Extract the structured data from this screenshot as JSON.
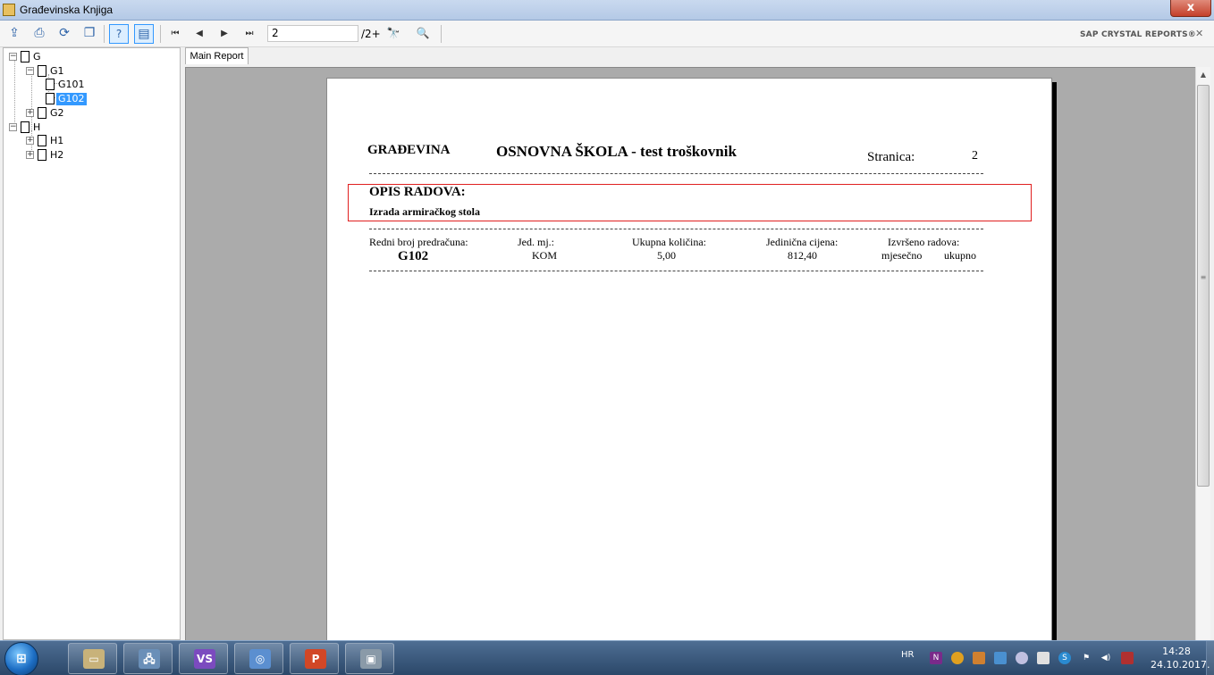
{
  "window": {
    "title": "Građevinska Knjiga",
    "close_label": "x"
  },
  "toolbar": {
    "buttons": [
      {
        "name": "export-icon",
        "glyph": "⇪"
      },
      {
        "name": "print-icon",
        "glyph": "⎙"
      },
      {
        "name": "refresh-icon",
        "glyph": "⟳"
      },
      {
        "name": "copy-icon",
        "glyph": "❐"
      },
      {
        "name": "help-icon",
        "glyph": "?"
      },
      {
        "name": "group-tree-icon",
        "glyph": "▤"
      }
    ],
    "nav": [
      {
        "name": "first-page-icon",
        "glyph": "⏮"
      },
      {
        "name": "prev-page-icon",
        "glyph": "◀"
      },
      {
        "name": "next-page-icon",
        "glyph": "▶"
      },
      {
        "name": "last-page-icon",
        "glyph": "⏭"
      }
    ],
    "page_value": "2",
    "page_total": "/2+",
    "find_glyph": "🔭",
    "zoom_glyph": "🔍",
    "brand": "SAP CRYSTAL REPORTS®",
    "brand_close": "✕"
  },
  "tree": {
    "nodes": [
      {
        "label": "G",
        "expander": "−",
        "level": 0,
        "selected": false
      },
      {
        "label": "G1",
        "expander": "−",
        "level": 1,
        "selected": false
      },
      {
        "label": "G101",
        "expander": "",
        "level": 2,
        "selected": false
      },
      {
        "label": "G102",
        "expander": "",
        "level": 2,
        "selected": true
      },
      {
        "label": "G2",
        "expander": "+",
        "level": 1,
        "selected": false
      },
      {
        "label": "H",
        "expander": "−",
        "level": 0,
        "selected": false
      },
      {
        "label": "H1",
        "expander": "+",
        "level": 1,
        "selected": false
      },
      {
        "label": "H2",
        "expander": "+",
        "level": 1,
        "selected": false
      }
    ]
  },
  "tabs": {
    "main_report": "Main Report"
  },
  "report": {
    "header_left": "GRAĐEVINA",
    "header_title": "OSNOVNA ŠKOLA - test troškovnik",
    "page_label": "Stranica:",
    "page_number": "2",
    "opis_heading": "OPIS RADOVA:",
    "opis_text": "Izrada armiračkog stola",
    "columns": {
      "redni_broj": "Redni broj predračuna:",
      "jed_mj": "Jed. mj.:",
      "ukupna_kolicina": "Ukupna količina:",
      "jedinicna_cijena": "Jedinična cijena:",
      "izvrseno": "Izvršeno radova:",
      "mjesecno": "mjesečno",
      "ukupno": "ukupno"
    },
    "row": {
      "redni_broj": "G102",
      "jed_mj": "KOM",
      "ukupna_kolicina": "5,00",
      "jedinicna_cijena": "812,40"
    }
  },
  "taskbar": {
    "start_glyph": "⊞",
    "apps": [
      {
        "name": "file-explorer-taskbar",
        "glyph": "▭",
        "color": "#c8b27a"
      },
      {
        "name": "network-taskbar",
        "glyph": "🖧",
        "color": "#6a8fb8"
      },
      {
        "name": "visual-studio-taskbar",
        "glyph": "VS",
        "color": "#7b4bbf"
      },
      {
        "name": "media-app-taskbar",
        "glyph": "◎",
        "color": "#5b8fd0"
      },
      {
        "name": "powerpoint-taskbar",
        "glyph": "P",
        "color": "#d24726"
      },
      {
        "name": "crystal-app-taskbar",
        "glyph": "▣",
        "color": "#8a9aa8"
      }
    ],
    "language": "HR",
    "time": "14:28",
    "date": "24.10.2017."
  }
}
